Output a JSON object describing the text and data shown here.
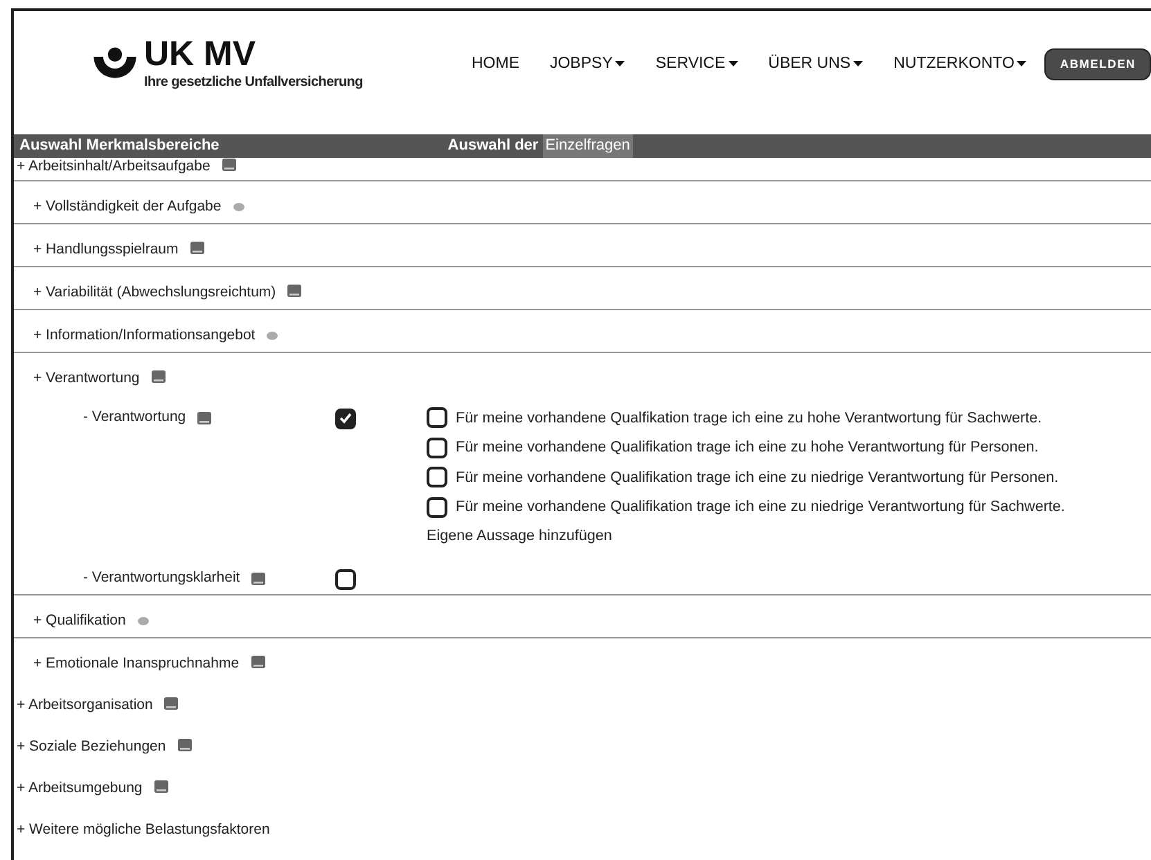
{
  "header": {
    "logo": {
      "name": "UK MV",
      "tagline": "Ihre gesetzliche Unfallversicherung"
    },
    "nav": [
      {
        "label": "HOME",
        "dropdown": false
      },
      {
        "label": "JOBPSY",
        "dropdown": true
      },
      {
        "label": "SERVICE",
        "dropdown": true
      },
      {
        "label": "ÜBER UNS",
        "dropdown": true
      },
      {
        "label": "NUTZERKONTO",
        "dropdown": true
      }
    ],
    "logout_button": "ABMELDEN"
  },
  "section_bar": {
    "left_heading": "Auswahl Merkmalsbereiche",
    "right_heading": "Auswahl der",
    "right_heading_highlight": "Einzelfragen"
  },
  "tree": [
    {
      "label": "+ Arbeitsinhalt/Arbeitsaufgabe",
      "kind": "note",
      "expanded": true,
      "children": [
        {
          "label": "+ Vollständigkeit der Aufgabe",
          "kind": "faded"
        },
        {
          "label": "+ Handlungsspielraum",
          "kind": "note"
        },
        {
          "label": "+ Variabilität (Abwechslungsreichtum)",
          "kind": "note"
        },
        {
          "label": "+ Information/Informationsangebot",
          "kind": "faded"
        },
        {
          "label": "+ Verantwortung",
          "kind": "note",
          "children": [
            {
              "label": "- Verantwortung",
              "kind": "note",
              "checked": true,
              "statements": [
                {
                  "text": "Für meine vorhandene Qualfikation trage ich eine zu hohe Verantwortung für Sachwerte.",
                  "checked": false
                },
                {
                  "text": "Für meine vorhandene Qualifikation trage ich eine zu hohe Verantwortung für Personen.",
                  "checked": false
                },
                {
                  "text": "Für meine vorhandene Qualifikation trage ich eine zu niedrige Verantwortung für Personen.",
                  "checked": false
                },
                {
                  "text": "Für meine vorhandene Qualifikation trage ich eine zu niedrige Verantwortung für Sachwerte.",
                  "checked": false
                }
              ],
              "add_link": "Eigene Aussage hinzufügen"
            },
            {
              "label": "- Verantwortungsklarheit",
              "kind": "note",
              "checked": false
            }
          ]
        },
        {
          "label": "+ Qualifikation",
          "kind": "faded"
        },
        {
          "label": "+ Emotionale Inanspruchnahme",
          "kind": "note"
        }
      ]
    },
    {
      "label": "+ Arbeitsorganisation",
      "kind": "note",
      "expanded": false
    },
    {
      "label": "+ Soziale Beziehungen",
      "kind": "note",
      "expanded": false
    },
    {
      "label": "+ Arbeitsumgebung",
      "kind": "note",
      "expanded": false
    },
    {
      "label": "+ Weitere mögliche Belastungsfaktoren",
      "kind": "plain",
      "expanded": false
    }
  ]
}
